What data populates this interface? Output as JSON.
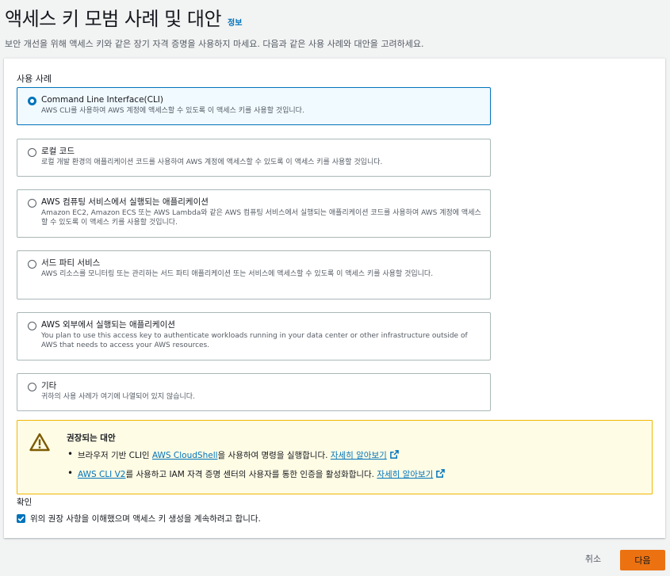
{
  "header": {
    "title": "액세스 키 모범 사례 및 대안",
    "info_link": "정보",
    "description": "보안 개선을 위해 액세스 키와 같은 장기 자격 증명을 사용하지 마세요. 다음과 같은 사용 사례와 대안을 고려하세요."
  },
  "use_cases": {
    "label": "사용 사례",
    "options": [
      {
        "title": "Command Line Interface(CLI)",
        "desc": "AWS CLI를 사용하여 AWS 계정에 액세스할 수 있도록 이 액세스 키를 사용할 것입니다.",
        "selected": true
      },
      {
        "title": "로컬 코드",
        "desc": "로컬 개발 환경의 애플리케이션 코드를 사용하여 AWS 계정에 액세스할 수 있도록 이 액세스 키를 사용할 것입니다.",
        "selected": false
      },
      {
        "title": "AWS 컴퓨팅 서비스에서 실행되는 애플리케이션",
        "desc": "Amazon EC2, Amazon ECS 또는 AWS Lambda와 같은 AWS 컴퓨팅 서비스에서 실행되는 애플리케이션 코드를 사용하여 AWS 계정에 액세스할 수 있도록 이 액세스 키를 사용할 것입니다.",
        "selected": false
      },
      {
        "title": "서드 파티 서비스",
        "desc": "AWS 리소스를 모니터링 또는 관리하는 서드 파티 애플리케이션 또는 서비스에 액세스할 수 있도록 이 액세스 키를 사용할 것입니다.",
        "selected": false
      },
      {
        "title": "AWS 외부에서 실행되는 애플리케이션",
        "desc": "You plan to use this access key to authenticate workloads running in your data center or other infrastructure outside of AWS that needs to access your AWS resources.",
        "selected": false
      },
      {
        "title": "기타",
        "desc": "귀하의 사용 사례가 여기에 나열되어 있지 않습니다.",
        "selected": false
      }
    ]
  },
  "alert": {
    "title": "권장되는 대안",
    "item1_prefix": "브라우저 기반 CLI인 ",
    "item1_link": "AWS CloudShell",
    "item1_mid": "을 사용하여 명령을 실행합니다. ",
    "item1_learn": "자세히 알아보기",
    "item2_link": "AWS CLI V2",
    "item2_mid": "를 사용하고 IAM 자격 증명 센터의 사용자를 통한 인증을 활성화합니다. ",
    "item2_learn": "자세히 알아보기"
  },
  "confirm": {
    "label": "확인",
    "checkbox_label": "위의 권장 사항을 이해했으며 액세스 키 생성을 계속하려고 합니다.",
    "checked": true
  },
  "footer": {
    "cancel": "취소",
    "next": "다음"
  },
  "colors": {
    "accent": "#0073bb",
    "warning": "#f2b702",
    "primary_button": "#ec7211"
  }
}
